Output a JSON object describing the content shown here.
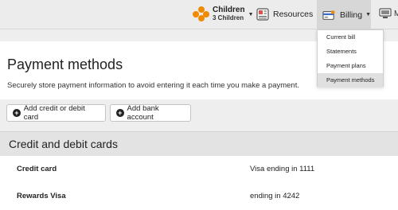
{
  "nav": {
    "children": {
      "label": "Children",
      "count": "3 Children",
      "icon": "children-icon"
    },
    "resources": {
      "label": "Resources",
      "icon": "resources-icon"
    },
    "billing": {
      "label": "Billing",
      "icon": "billing-icon"
    },
    "extra": {
      "label": "M",
      "icon": "monitor-icon"
    },
    "caret": "▼"
  },
  "billing_menu": {
    "items": [
      "Current bill",
      "Statements",
      "Payment plans",
      "Payment methods"
    ],
    "active_index": 3
  },
  "page": {
    "title": "Payment methods",
    "subtitle": "Securely store payment information to avoid entering it each time you make a payment."
  },
  "actions": {
    "add_card": "Add credit or debit card",
    "add_bank": "Add bank account",
    "plus_glyph": "+"
  },
  "cards_section": {
    "title": "Credit and debit cards",
    "rows": [
      {
        "name": "Credit card",
        "value": "Visa ending in 1111"
      },
      {
        "name": "Rewards Visa",
        "value": "ending in 4242"
      }
    ]
  },
  "colors": {
    "accent_orange": "#f08a00",
    "selected_tab": "#d7d7d7"
  }
}
